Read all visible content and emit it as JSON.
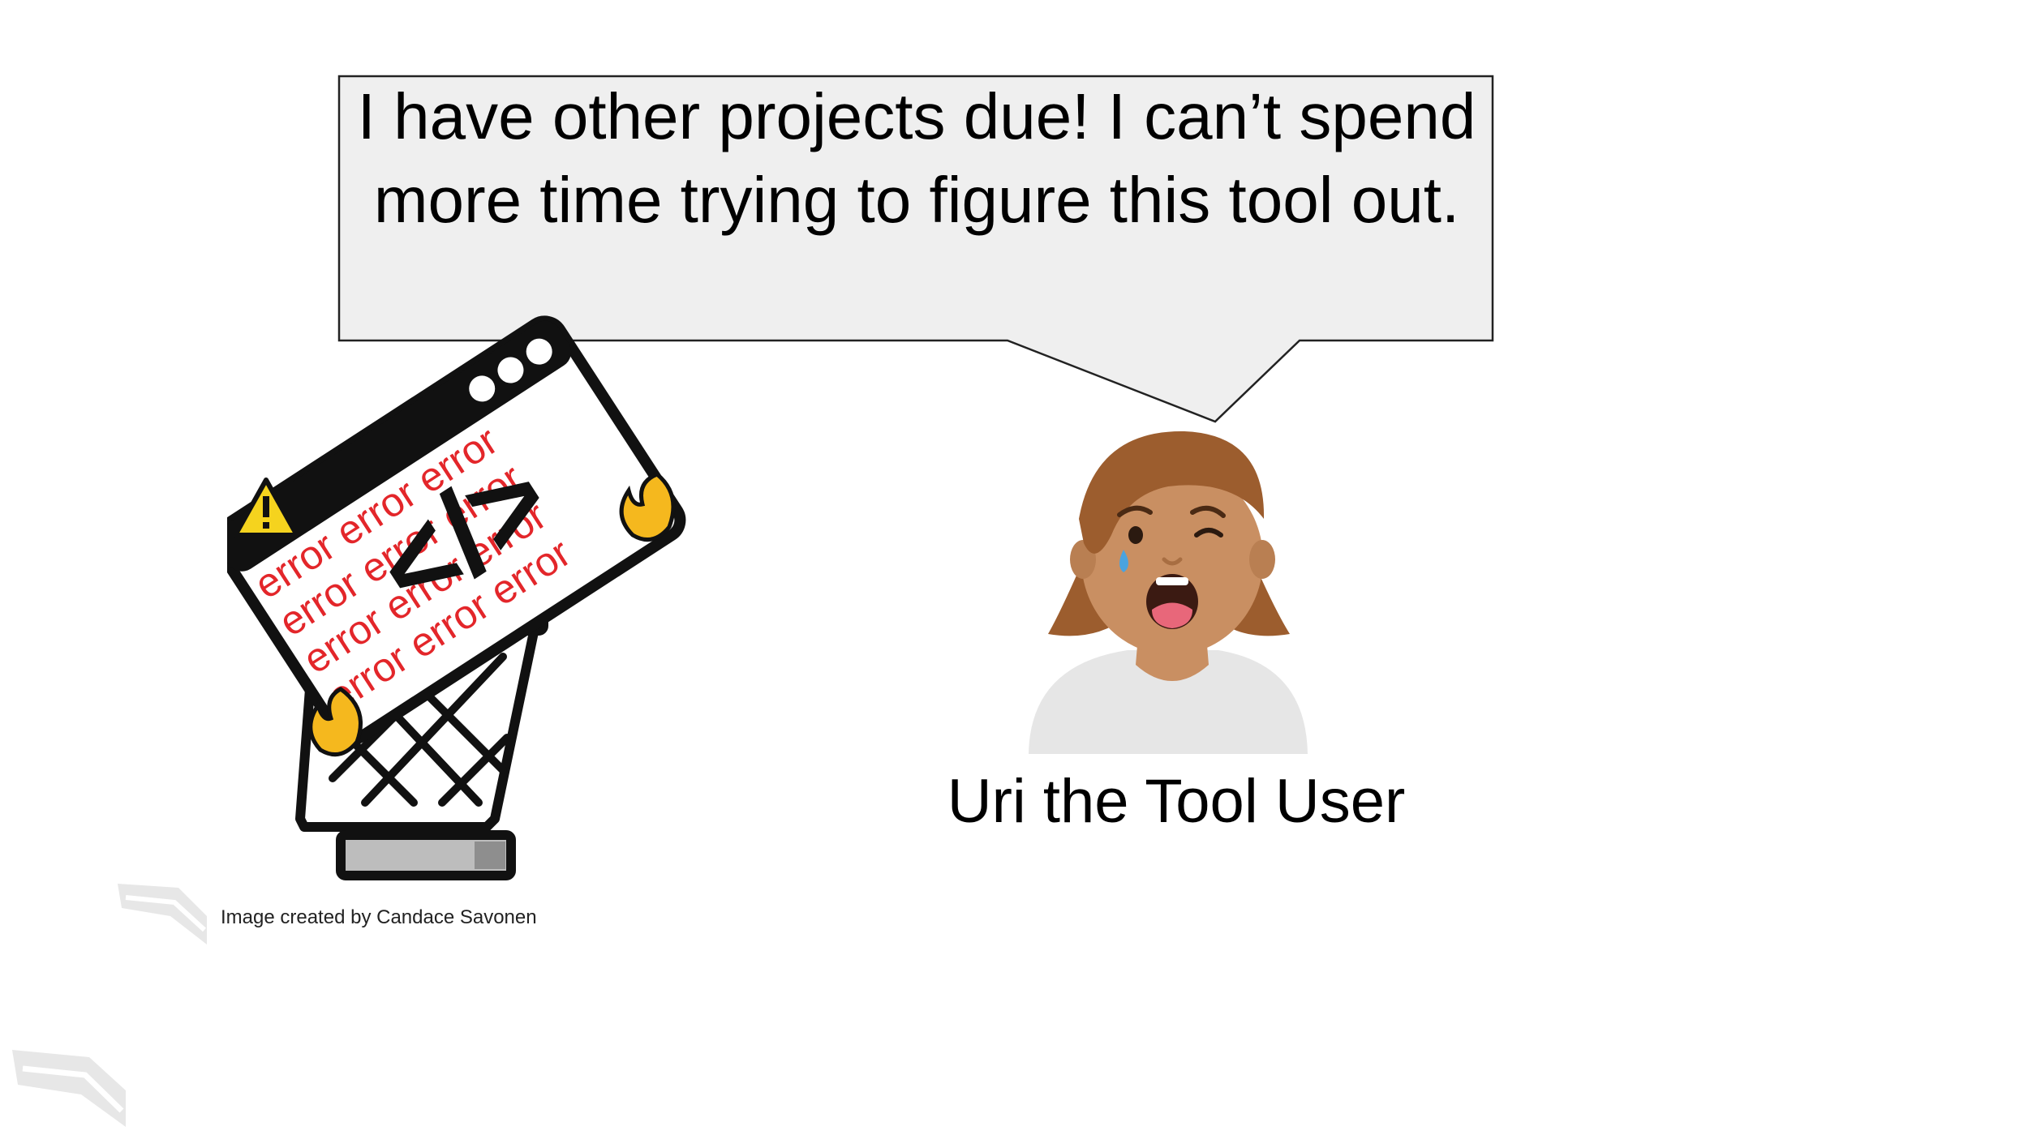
{
  "speech_bubble": {
    "text": "I have other projects due! I can’t spend more time trying to figure this tool out."
  },
  "user": {
    "name": "Uri the Tool User"
  },
  "credit": {
    "text": "Image created by Candace Savonen"
  },
  "illustration": {
    "window_text": "error error error",
    "code_symbol": "</>"
  },
  "colors": {
    "bubble_fill": "#efefef",
    "error_red": "#e3262a",
    "skin": "#c98f62",
    "hair": "#9c5d2e",
    "shirt": "#e6e6e6",
    "tear": "#4aa3df",
    "fire": "#f5b81e"
  }
}
